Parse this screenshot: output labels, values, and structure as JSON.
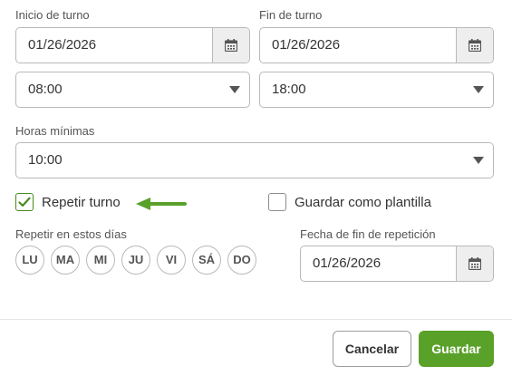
{
  "shift_start": {
    "label": "Inicio de turno",
    "date": "01/26/2026",
    "time": "08:00"
  },
  "shift_end": {
    "label": "Fin de turno",
    "date": "01/26/2026",
    "time": "18:00"
  },
  "min_hours": {
    "label": "Horas mínimas",
    "value": "10:00"
  },
  "repeat_shift": {
    "label": "Repetir turno",
    "checked": true
  },
  "save_template": {
    "label": "Guardar como plantilla",
    "checked": false
  },
  "repeat_days": {
    "label": "Repetir en estos días",
    "days": [
      "LU",
      "MA",
      "MI",
      "JU",
      "VI",
      "SÁ",
      "DO"
    ]
  },
  "repeat_end": {
    "label": "Fecha de fin de repetición",
    "date": "01/26/2026"
  },
  "footer": {
    "cancel_label": "Cancelar",
    "save_label": "Guardar"
  },
  "icons": {
    "calendar": "calendar-icon",
    "dropdown": "chevron-down-icon",
    "check": "check-icon",
    "annotation_arrow": "arrow-left-icon"
  },
  "colors": {
    "accent_green": "#5aa12a",
    "check_green": "#4a8a1c",
    "border": "#b9b9b9",
    "calendar_bg": "#eeeeee"
  }
}
